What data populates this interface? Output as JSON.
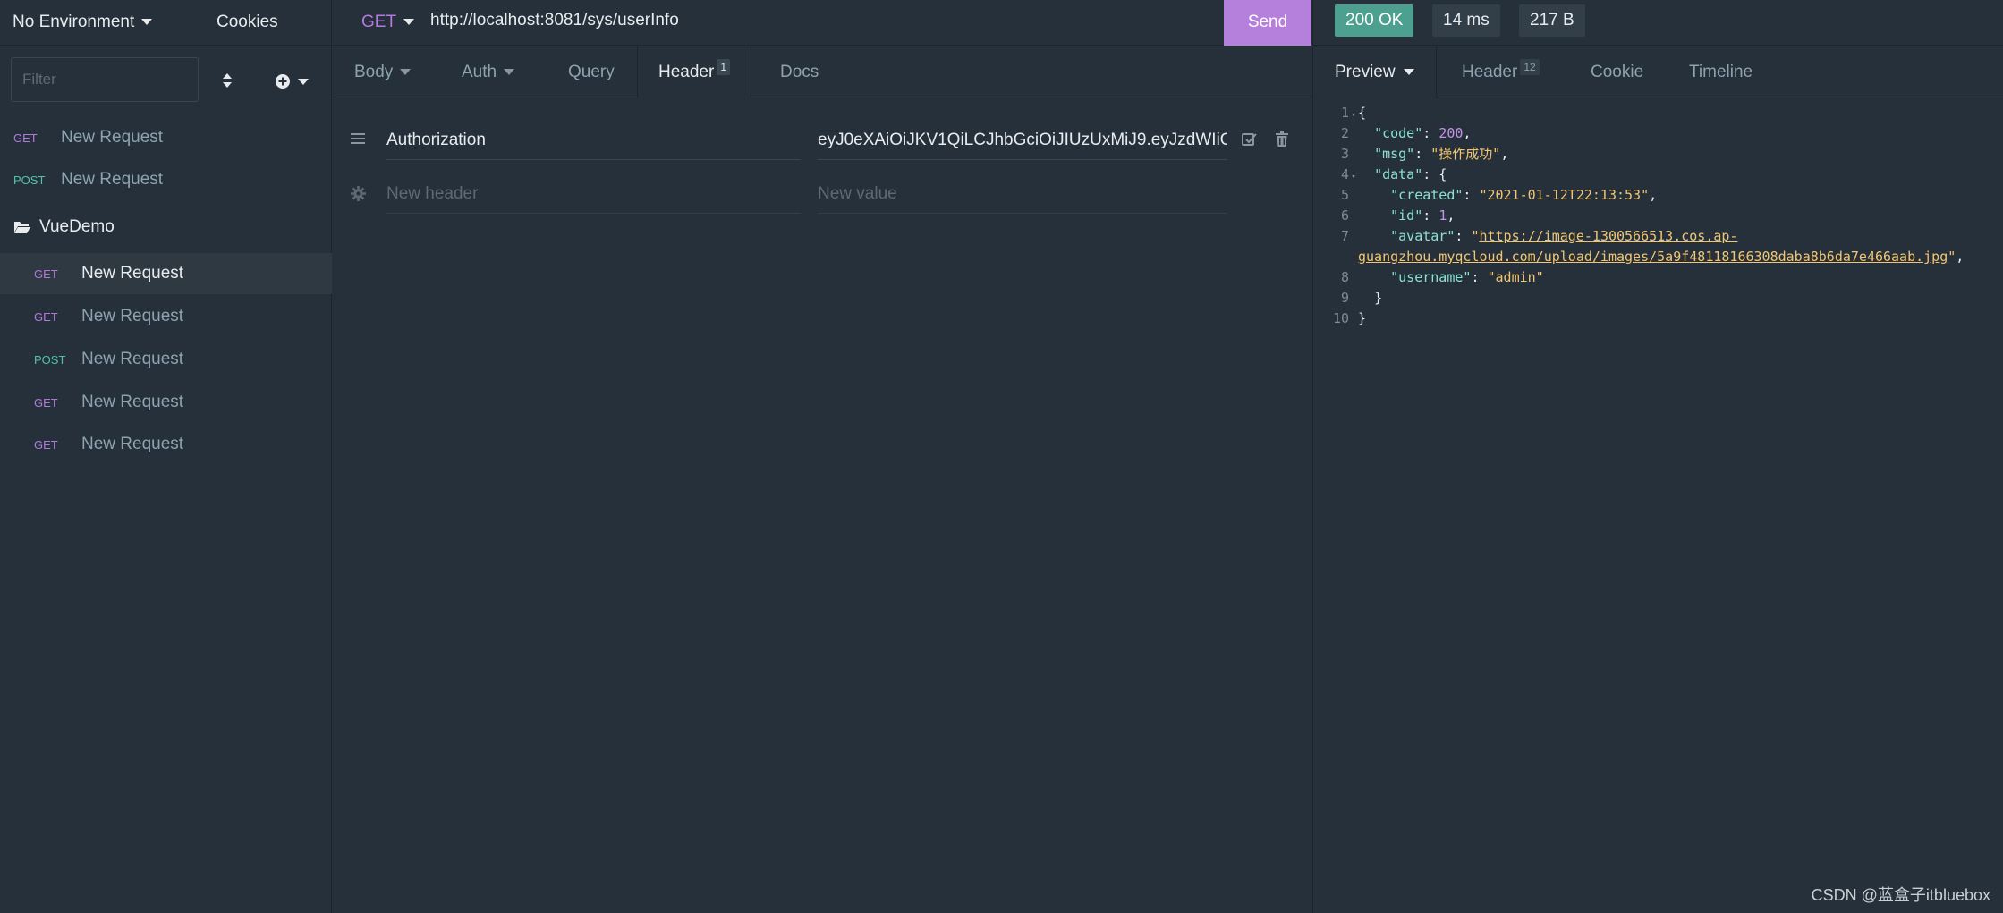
{
  "sidebar": {
    "environment": "No Environment",
    "cookies": "Cookies",
    "filter_placeholder": "Filter",
    "items": [
      {
        "method": "GET",
        "name": "New Request"
      },
      {
        "method": "POST",
        "name": "New Request"
      }
    ],
    "folder": {
      "name": "VueDemo",
      "items": [
        {
          "method": "GET",
          "name": "New Request",
          "active": true
        },
        {
          "method": "GET",
          "name": "New Request"
        },
        {
          "method": "POST",
          "name": "New Request"
        },
        {
          "method": "GET",
          "name": "New Request"
        },
        {
          "method": "GET",
          "name": "New Request"
        }
      ]
    }
  },
  "request": {
    "method": "GET",
    "url": "http://localhost:8081/sys/userInfo",
    "send_label": "Send",
    "tabs": {
      "body": "Body",
      "auth": "Auth",
      "query": "Query",
      "header": "Header",
      "header_count": "1",
      "docs": "Docs"
    },
    "headers": [
      {
        "name": "Authorization",
        "value": "eyJ0eXAiOiJKV1QiLCJhbGciOiJIUzUxMiJ9.eyJzdWIiOiJ"
      }
    ],
    "new_header_placeholder": "New header",
    "new_value_placeholder": "New value"
  },
  "response": {
    "status": "200 OK",
    "time": "14 ms",
    "size": "217 B",
    "tabs": {
      "preview": "Preview",
      "header": "Header",
      "header_count": "12",
      "cookie": "Cookie",
      "timeline": "Timeline"
    },
    "body_lines": {
      "l1_open": "{",
      "code_key": "\"code\"",
      "code_val": "200",
      "msg_key": "\"msg\"",
      "msg_val": "\"操作成功\"",
      "data_key": "\"data\"",
      "created_key": "\"created\"",
      "created_val": "\"2021-01-12T22:13:53\"",
      "id_key": "\"id\"",
      "id_val": "1",
      "avatar_key": "\"avatar\"",
      "avatar_val_1": "https://image-1300566513.cos.ap-",
      "avatar_val_2": "guangzhou.myqcloud.com/upload/images/5a9f48118166308daba8b6da7e466aab.jpg",
      "username_key": "\"username\"",
      "username_val": "\"admin\"",
      "l9_close": "}",
      "l10_close": "}"
    }
  },
  "watermark": "CSDN @蓝盒子itbluebox",
  "colors": {
    "background": "#25303a",
    "send_button": "#b480dc",
    "status_ok": "#4d9f8f",
    "method_get": "#b479de",
    "method_post": "#4fc3a8"
  }
}
